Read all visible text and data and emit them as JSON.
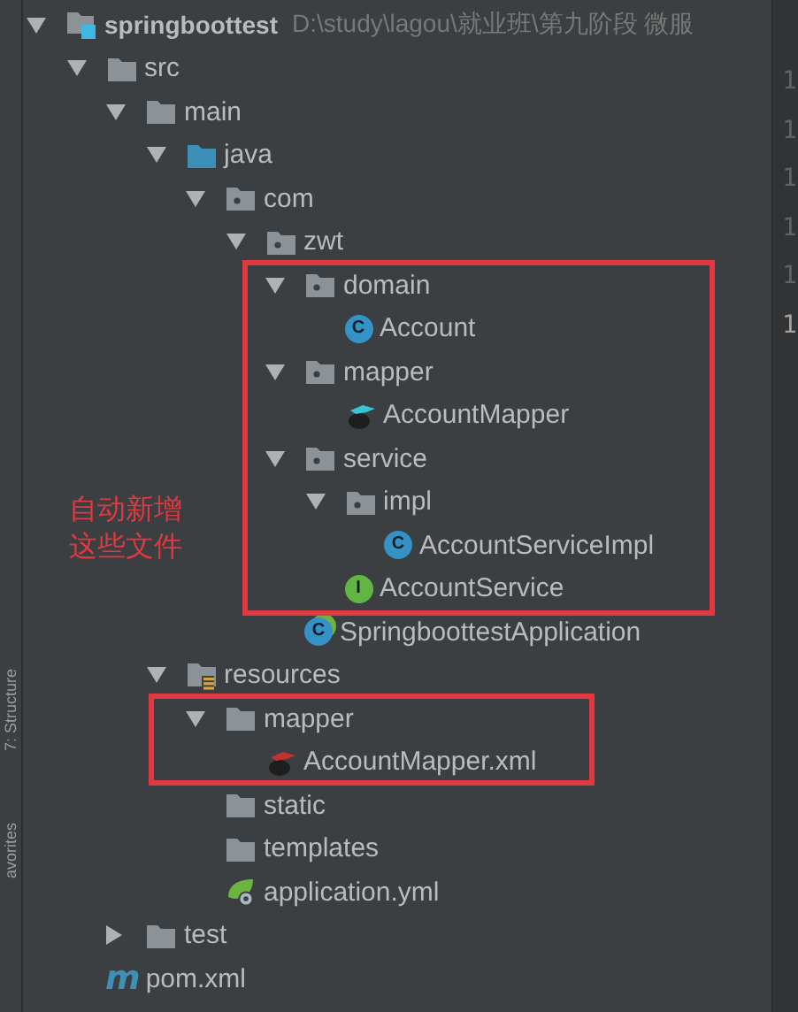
{
  "side_tabs": [
    {
      "label": "7: Structure"
    },
    {
      "label": "avorites"
    }
  ],
  "project_tree": {
    "nodes": [
      {
        "name": "springboottest",
        "kind": "module",
        "expanded": true,
        "path": "D:\\study\\lagou\\就业班\\第九阶段 微服",
        "children": [
          {
            "name": "src",
            "kind": "folder",
            "expanded": true,
            "children": [
              {
                "name": "main",
                "kind": "folder",
                "expanded": true,
                "children": [
                  {
                    "name": "java",
                    "kind": "source-folder",
                    "expanded": true,
                    "children": [
                      {
                        "name": "com",
                        "kind": "package",
                        "expanded": true,
                        "children": [
                          {
                            "name": "zwt",
                            "kind": "package",
                            "expanded": true,
                            "children": [
                              {
                                "name": "domain",
                                "kind": "package",
                                "expanded": true,
                                "children": [
                                  {
                                    "name": "Account",
                                    "kind": "class",
                                    "badge": "C"
                                  }
                                ]
                              },
                              {
                                "name": "mapper",
                                "kind": "package",
                                "expanded": true,
                                "children": [
                                  {
                                    "name": "AccountMapper",
                                    "kind": "mapper-java"
                                  }
                                ]
                              },
                              {
                                "name": "service",
                                "kind": "package",
                                "expanded": true,
                                "children": [
                                  {
                                    "name": "impl",
                                    "kind": "package",
                                    "expanded": true,
                                    "children": [
                                      {
                                        "name": "AccountServiceImpl",
                                        "kind": "class",
                                        "badge": "C"
                                      }
                                    ]
                                  },
                                  {
                                    "name": "AccountService",
                                    "kind": "interface",
                                    "badge": "I"
                                  }
                                ]
                              },
                              {
                                "name": "SpringboottestApplication",
                                "kind": "spring-app",
                                "badge": "C"
                              }
                            ]
                          }
                        ]
                      }
                    ]
                  },
                  {
                    "name": "resources",
                    "kind": "resource-folder",
                    "expanded": true,
                    "children": [
                      {
                        "name": "mapper",
                        "kind": "folder",
                        "expanded": true,
                        "children": [
                          {
                            "name": "AccountMapper.xml",
                            "kind": "mapper-xml"
                          }
                        ]
                      },
                      {
                        "name": "static",
                        "kind": "folder"
                      },
                      {
                        "name": "templates",
                        "kind": "folder"
                      },
                      {
                        "name": "application.yml",
                        "kind": "yml"
                      }
                    ]
                  }
                ]
              },
              {
                "name": "test",
                "kind": "folder",
                "expanded": false
              }
            ]
          },
          {
            "name": "pom.xml",
            "kind": "maven",
            "badge": "m"
          }
        ]
      }
    ]
  },
  "annotation": {
    "note_lines": [
      "自动新增",
      "这些文件"
    ]
  },
  "gutter": {
    "line_numbers": [
      {
        "text": "1",
        "current": false
      },
      {
        "text": "1",
        "current": false
      },
      {
        "text": "1",
        "current": false
      },
      {
        "text": "1",
        "current": false
      },
      {
        "text": "1",
        "current": false
      },
      {
        "text": "1",
        "current": true
      }
    ]
  }
}
